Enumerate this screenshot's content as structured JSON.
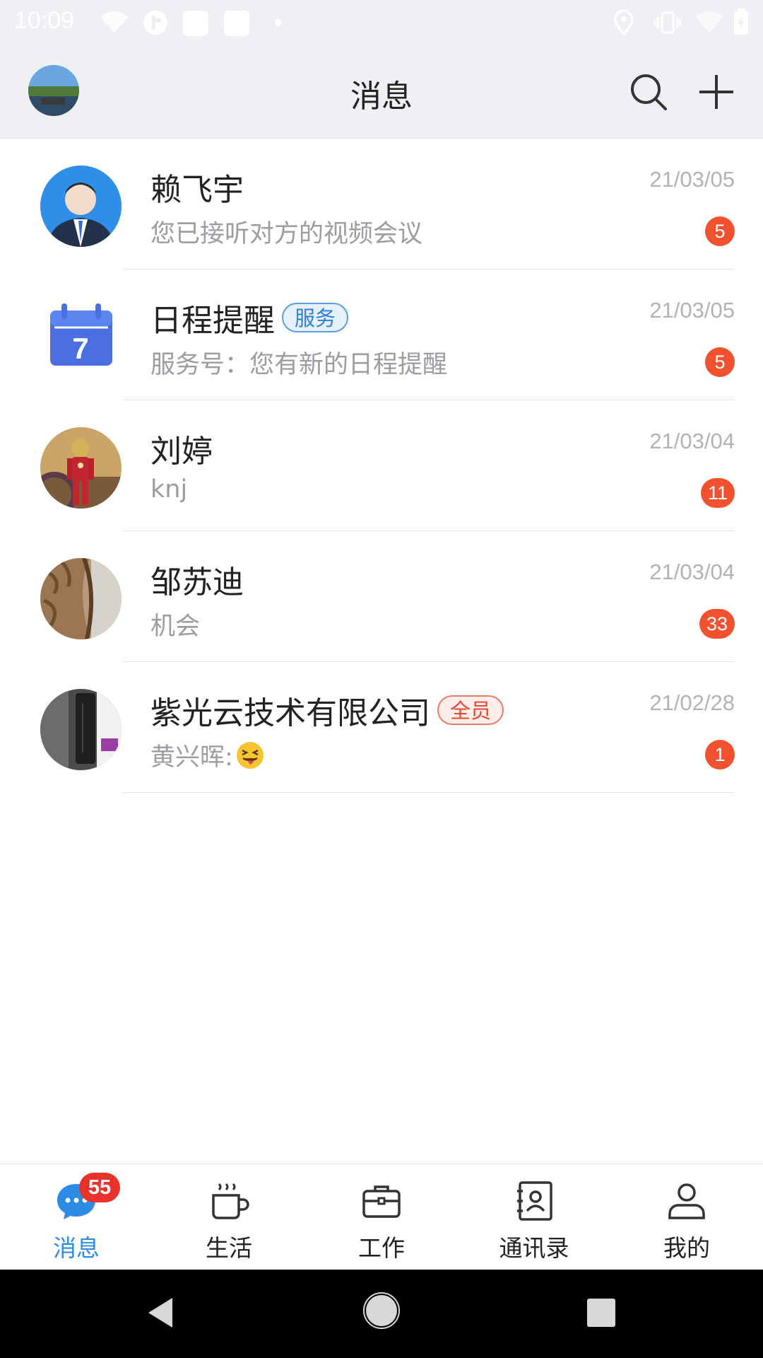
{
  "status_bar": {
    "time": "10:09"
  },
  "header": {
    "title": "消息"
  },
  "conversations": [
    {
      "name": "赖飞宇",
      "tag": "",
      "date": "21/03/05",
      "preview": "您已接听对方的视频会议",
      "emoji": "",
      "unread": "5"
    },
    {
      "name": "日程提醒",
      "tag": "服务",
      "date": "21/03/05",
      "preview": "服务号：您有新的日程提醒",
      "emoji": "",
      "unread": "5"
    },
    {
      "name": "刘婷",
      "tag": "",
      "date": "21/03/04",
      "preview": "knj",
      "emoji": "",
      "unread": "11"
    },
    {
      "name": "邹苏迪",
      "tag": "",
      "date": "21/03/04",
      "preview": "机会",
      "emoji": "",
      "unread": "33"
    },
    {
      "name": "紫光云技术有限公司",
      "tag": "全员",
      "date": "21/02/28",
      "preview": "黄兴晖: ",
      "emoji": "😝",
      "unread": "1"
    }
  ],
  "calendar_icon_day": "7",
  "tabs": [
    {
      "label": "消息",
      "badge": "55",
      "active": true,
      "icon": "chat-icon"
    },
    {
      "label": "生活",
      "badge": "",
      "active": false,
      "icon": "coffee-cup-icon"
    },
    {
      "label": "工作",
      "badge": "",
      "active": false,
      "icon": "briefcase-icon"
    },
    {
      "label": "通讯录",
      "badge": "",
      "active": false,
      "icon": "contacts-book-icon"
    },
    {
      "label": "我的",
      "badge": "",
      "active": false,
      "icon": "person-icon"
    }
  ],
  "colors": {
    "accent": "#2c8ce5",
    "badge": "#f2512f",
    "header_bg": "#eef0f3"
  }
}
